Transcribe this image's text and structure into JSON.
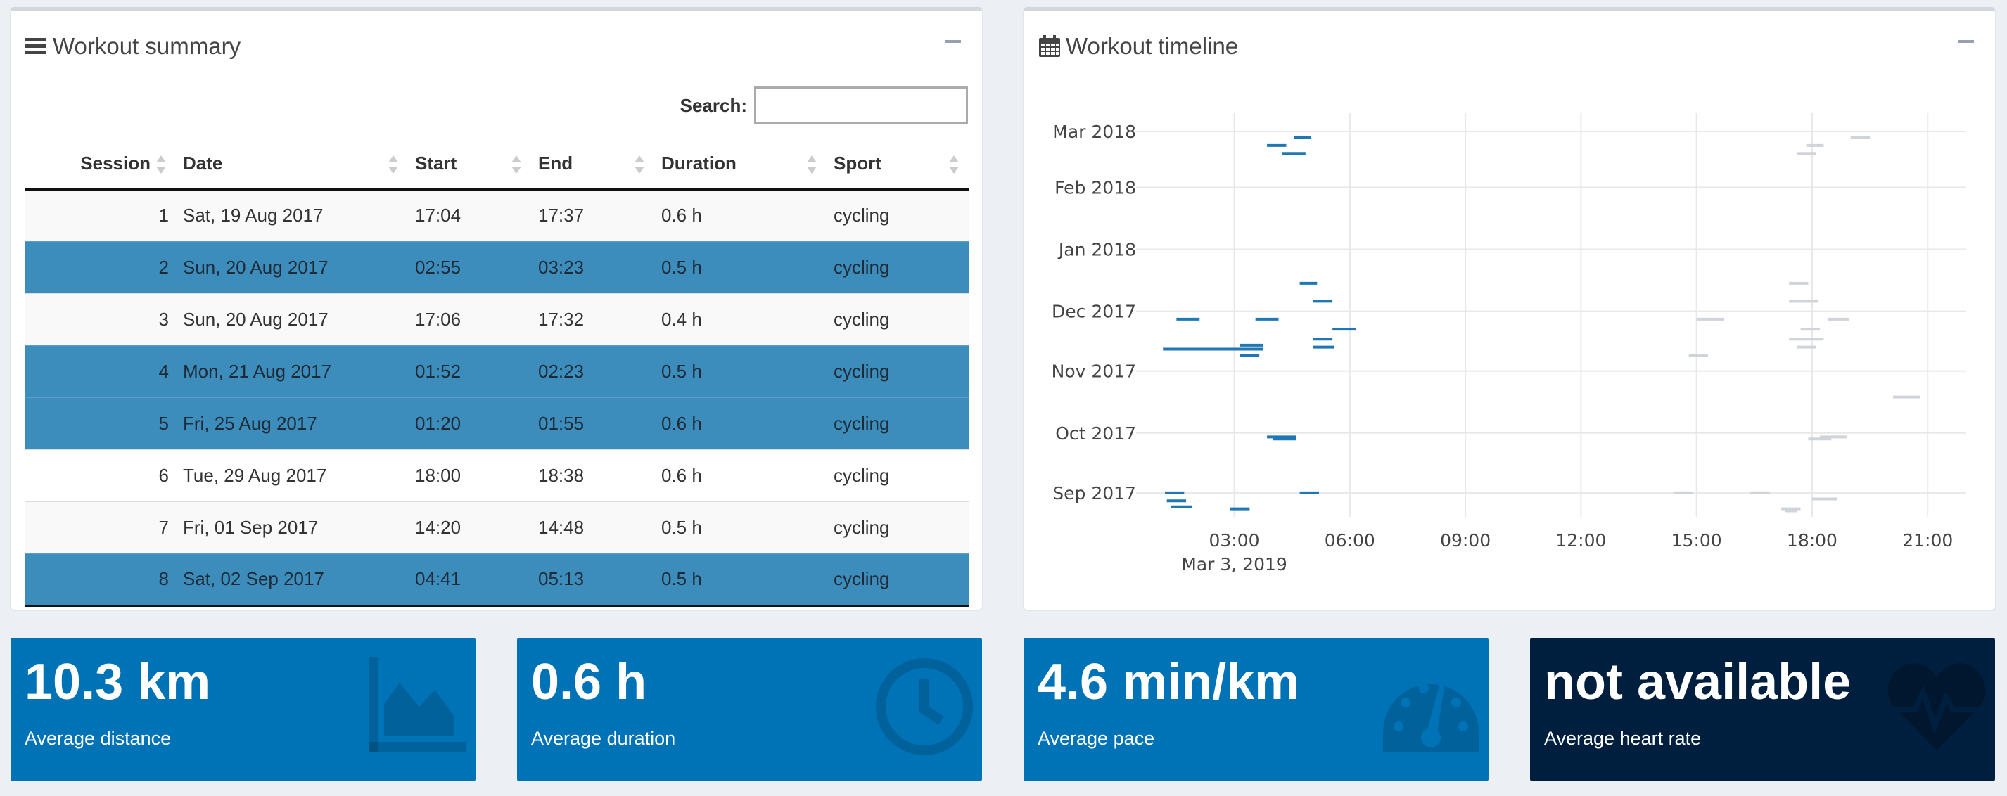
{
  "summary_box": {
    "title": "Workout summary",
    "search_label": "Search:",
    "search_value": "",
    "columns": [
      "Session",
      "Date",
      "Start",
      "End",
      "Duration",
      "Sport"
    ],
    "rows": [
      {
        "session": "1",
        "date": "Sat, 19 Aug 2017",
        "start": "17:04",
        "end": "17:37",
        "duration": "0.6 h",
        "sport": "cycling",
        "selected": false
      },
      {
        "session": "2",
        "date": "Sun, 20 Aug 2017",
        "start": "02:55",
        "end": "03:23",
        "duration": "0.5 h",
        "sport": "cycling",
        "selected": true
      },
      {
        "session": "3",
        "date": "Sun, 20 Aug 2017",
        "start": "17:06",
        "end": "17:32",
        "duration": "0.4 h",
        "sport": "cycling",
        "selected": false
      },
      {
        "session": "4",
        "date": "Mon, 21 Aug 2017",
        "start": "01:52",
        "end": "02:23",
        "duration": "0.5 h",
        "sport": "cycling",
        "selected": true
      },
      {
        "session": "5",
        "date": "Fri, 25 Aug 2017",
        "start": "01:20",
        "end": "01:55",
        "duration": "0.6 h",
        "sport": "cycling",
        "selected": true
      },
      {
        "session": "6",
        "date": "Tue, 29 Aug 2017",
        "start": "18:00",
        "end": "18:38",
        "duration": "0.6 h",
        "sport": "cycling",
        "selected": false
      },
      {
        "session": "7",
        "date": "Fri, 01 Sep 2017",
        "start": "14:20",
        "end": "14:48",
        "duration": "0.5 h",
        "sport": "cycling",
        "selected": false
      },
      {
        "session": "8",
        "date": "Sat, 02 Sep 2017",
        "start": "04:41",
        "end": "05:13",
        "duration": "0.5 h",
        "sport": "cycling",
        "selected": true
      }
    ]
  },
  "timeline_box": {
    "title": "Workout timeline"
  },
  "chart_data": {
    "type": "timeline",
    "x_tick_labels": [
      "03:00",
      "06:00",
      "09:00",
      "12:00",
      "15:00",
      "18:00",
      "21:00"
    ],
    "x_sub_label": "Mar 3, 2019",
    "y_tick_labels": [
      "Mar 2018",
      "Feb 2018",
      "Jan 2018",
      "Dec 2017",
      "Nov 2017",
      "Oct 2017",
      "Sep 2017"
    ],
    "x_range_hours": [
      1.0,
      22.0
    ],
    "grid": true,
    "colors": {
      "selected": "#1f77b4",
      "unselected": "#cfd3da"
    },
    "segments": [
      {
        "day": "2018-02-26",
        "start": 4.55,
        "end": 5.0,
        "selected": true
      },
      {
        "day": "2018-02-22",
        "start": 3.85,
        "end": 4.35,
        "selected": true
      },
      {
        "day": "2018-02-18",
        "start": 4.25,
        "end": 4.85,
        "selected": true
      },
      {
        "day": "2017-12-15",
        "start": 4.7,
        "end": 5.15,
        "selected": true
      },
      {
        "day": "2017-12-06",
        "start": 5.05,
        "end": 5.55,
        "selected": true
      },
      {
        "day": "2017-11-27",
        "start": 1.5,
        "end": 2.1,
        "selected": true
      },
      {
        "day": "2017-11-27",
        "start": 3.55,
        "end": 4.15,
        "selected": true
      },
      {
        "day": "2017-11-22",
        "start": 5.55,
        "end": 6.15,
        "selected": true
      },
      {
        "day": "2017-11-17",
        "start": 5.05,
        "end": 5.55,
        "selected": true
      },
      {
        "day": "2017-11-14",
        "start": 3.15,
        "end": 3.75,
        "selected": true
      },
      {
        "day": "2017-11-13",
        "start": 5.05,
        "end": 5.6,
        "selected": true
      },
      {
        "day": "2017-11-12",
        "start": 1.15,
        "end": 3.75,
        "selected": true
      },
      {
        "day": "2017-11-09",
        "start": 3.15,
        "end": 3.65,
        "selected": true
      },
      {
        "day": "2017-09-29",
        "start": 3.85,
        "end": 4.6,
        "selected": true
      },
      {
        "day": "2017-09-28",
        "start": 4.0,
        "end": 4.6,
        "selected": true
      },
      {
        "day": "2017-09-01",
        "start": 1.2,
        "end": 1.7,
        "selected": true
      },
      {
        "day": "2017-09-01",
        "start": 4.7,
        "end": 5.2,
        "selected": true
      },
      {
        "day": "2017-08-28",
        "start": 1.25,
        "end": 1.75,
        "selected": true
      },
      {
        "day": "2017-08-25",
        "start": 1.35,
        "end": 1.9,
        "selected": true
      },
      {
        "day": "2017-08-24",
        "start": 2.9,
        "end": 3.4,
        "selected": true
      },
      {
        "day": "2018-02-26",
        "start": 19.0,
        "end": 19.5,
        "selected": false
      },
      {
        "day": "2018-02-22",
        "start": 17.85,
        "end": 18.3,
        "selected": false
      },
      {
        "day": "2018-02-18",
        "start": 17.6,
        "end": 18.1,
        "selected": false
      },
      {
        "day": "2017-12-15",
        "start": 17.4,
        "end": 17.9,
        "selected": false
      },
      {
        "day": "2017-12-06",
        "start": 17.4,
        "end": 18.15,
        "selected": false
      },
      {
        "day": "2017-11-27",
        "start": 15.0,
        "end": 15.7,
        "selected": false
      },
      {
        "day": "2017-11-27",
        "start": 18.4,
        "end": 18.95,
        "selected": false
      },
      {
        "day": "2017-11-22",
        "start": 17.7,
        "end": 18.2,
        "selected": false
      },
      {
        "day": "2017-11-17",
        "start": 17.4,
        "end": 18.3,
        "selected": false
      },
      {
        "day": "2017-11-13",
        "start": 17.6,
        "end": 18.1,
        "selected": false
      },
      {
        "day": "2017-11-09",
        "start": 14.8,
        "end": 15.3,
        "selected": false
      },
      {
        "day": "2017-10-19",
        "start": 20.1,
        "end": 20.8,
        "selected": false
      },
      {
        "day": "2017-09-29",
        "start": 18.2,
        "end": 18.9,
        "selected": false
      },
      {
        "day": "2017-09-28",
        "start": 17.9,
        "end": 18.5,
        "selected": false
      },
      {
        "day": "2017-09-01",
        "start": 14.4,
        "end": 14.9,
        "selected": false
      },
      {
        "day": "2017-09-01",
        "start": 16.4,
        "end": 16.9,
        "selected": false
      },
      {
        "day": "2017-08-29",
        "start": 18.0,
        "end": 18.65,
        "selected": false
      },
      {
        "day": "2017-08-24",
        "start": 17.2,
        "end": 17.7,
        "selected": false
      },
      {
        "day": "2017-08-23",
        "start": 17.3,
        "end": 17.6,
        "selected": false
      }
    ]
  },
  "value_boxes": [
    {
      "value": "10.3 km",
      "label": "Average distance",
      "icon": "area-chart-icon",
      "color": "#0073b7"
    },
    {
      "value": "0.6 h",
      "label": "Average duration",
      "icon": "clock-icon",
      "color": "#0073b7"
    },
    {
      "value": "4.6 min/km",
      "label": "Average pace",
      "icon": "tachometer-icon",
      "color": "#0073b7"
    },
    {
      "value": "not available",
      "label": "Average heart rate",
      "icon": "heartbeat-icon",
      "color": "#001f3f"
    }
  ]
}
